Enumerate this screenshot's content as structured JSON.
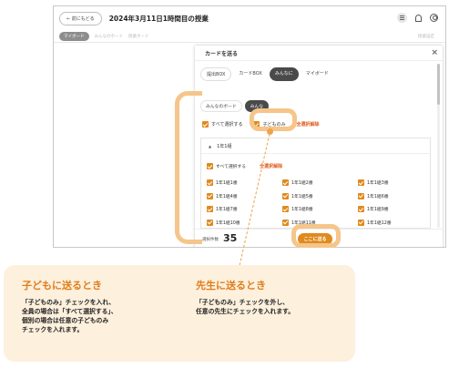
{
  "topbar": {
    "back_label": "← 前にもどる",
    "title": "2024年3月11日1時間目の授業"
  },
  "subbar": {
    "items": [
      "マイボード",
      "みんなのボード",
      "授業ボード"
    ],
    "right": "授業設定"
  },
  "modal": {
    "title": "カードを送る",
    "close": "×",
    "tabs": [
      "提出BOX",
      "カードBOX",
      "みんなに",
      "マイボード"
    ],
    "subtabs": [
      "みんなのボード",
      "みんな"
    ],
    "select_all": "すべて選択する",
    "children_only": "子どものみ",
    "deselect_all": "全選択解除",
    "class_name": "1年1組",
    "class_select_all": "すべて選択する",
    "class_deselect_all": "全選択解除",
    "students": [
      "1年1組1番",
      "1年1組2番",
      "1年1組3番",
      "1年1組4番",
      "1年1組5番",
      "1年1組6番",
      "1年1組7番",
      "1年1組8番",
      "1年1組9番",
      "1年1組10番",
      "1年1組11番",
      "1年1組12番"
    ],
    "count_label": "選択件数",
    "count": "35",
    "send_label": "ここに送る"
  },
  "callout": {
    "left_title": "子どもに送るとき",
    "left_body": "「子どものみ」チェックを入れ、\n全員の場合は「すべて選択する」、\n個別の場合は任意の子どものみ\nチェックを入れます。",
    "right_title": "先生に送るとき",
    "right_body": "「子どものみ」チェックを外し、\n任意の先生にチェックを入れます。"
  },
  "colors": {
    "accent": "#e08a1e",
    "highlight": "#f5c58a",
    "callout_bg": "#fdf0dd",
    "deselect": "#e05a1e"
  }
}
